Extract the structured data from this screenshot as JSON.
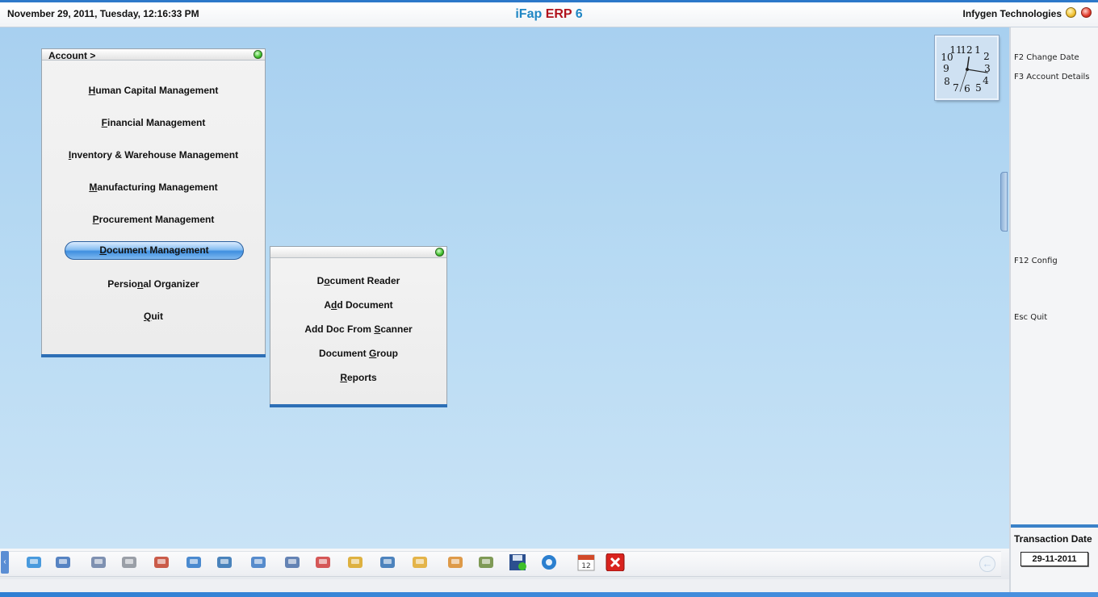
{
  "header": {
    "datetime": "November  29, 2011, Tuesday, 12:16:33 PM",
    "title_part1": "iFap",
    "title_part2": "ERP",
    "title_part3": "6",
    "company": "Infygen Technologies"
  },
  "account_panel": {
    "title": "Account >",
    "items": [
      {
        "ul": "H",
        "rest": "uman Capital Management"
      },
      {
        "ul": "F",
        "rest": "inancial Management"
      },
      {
        "ul": "I",
        "rest": "nventory & Warehouse Management"
      },
      {
        "ul": "M",
        "rest": "anufacturing Management"
      },
      {
        "ul": "P",
        "rest": "rocurement Management"
      },
      {
        "ul": "D",
        "rest": "ocument Management"
      },
      {
        "pre": "Persio",
        "ul": "n",
        "rest": "al Organizer"
      },
      {
        "ul": "Q",
        "rest": "uit"
      }
    ],
    "selected_index": 5
  },
  "document_panel": {
    "items": [
      {
        "pre": "D",
        "ul": "o",
        "rest": "cument Reader"
      },
      {
        "pre": "A",
        "ul": "d",
        "rest": "d Document"
      },
      {
        "pre": "Add Doc From ",
        "ul": "S",
        "rest": "canner"
      },
      {
        "pre": "Document ",
        "ul": "G",
        "rest": "roup"
      },
      {
        "pre": "",
        "ul": "R",
        "rest": "eports"
      }
    ]
  },
  "hotkeys": {
    "f2": "F2 Change Date",
    "f3": "F3 Account Details",
    "f12": "F12 Config",
    "esc": "Esc Quit"
  },
  "transaction": {
    "label": "Transaction Date",
    "value": "29-11-2011"
  },
  "clock": {
    "hour": 12,
    "minute": 16,
    "second": 33
  },
  "taskbar_icons": [
    "hierarchy-icon",
    "user-search-icon",
    "people-icon",
    "gears-icon",
    "books-icon",
    "cart-icon",
    "transfer-icon",
    "window-icon",
    "document-icon",
    "factory-icon",
    "tree-icon",
    "network-icon",
    "folder-icon",
    "organizer-icon",
    "checklist-icon",
    "save-icon",
    "settings-icon",
    "calendar-icon",
    "close-icon"
  ],
  "calendar_day": "12",
  "colors": {
    "accent": "#2c78c9",
    "title_blue": "#1f86c4",
    "title_red": "#b1121c",
    "selected": "#3f8fe0"
  }
}
